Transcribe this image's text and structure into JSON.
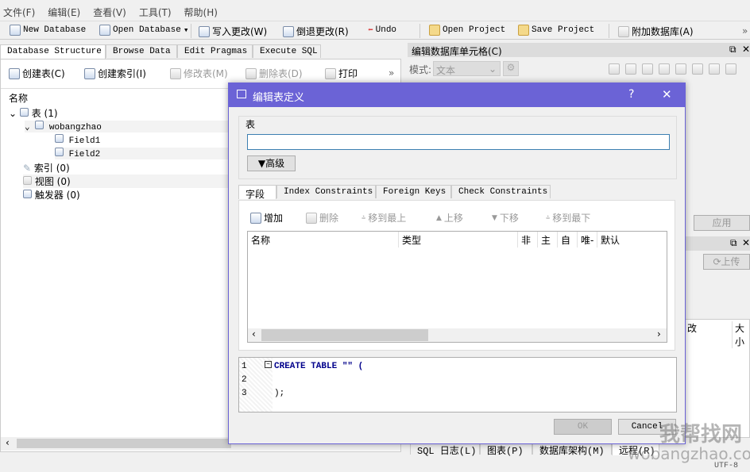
{
  "menu": [
    "文件(F)",
    "编辑(E)",
    "查看(V)",
    "工具(T)",
    "帮助(H)"
  ],
  "toolbar": {
    "new_db": "New Database",
    "open_db": "Open Database",
    "write": "写入更改(W)",
    "revert": "倒退更改(R)",
    "undo": "Undo",
    "open_project": "Open Project",
    "save_project": "Save Project",
    "attach": "附加数据库(A)",
    "more": "»"
  },
  "main_tabs": [
    "Database Structure",
    "Browse Data",
    "Edit Pragmas",
    "Execute SQL"
  ],
  "structure_toolbar": {
    "create_table": "创建表(C)",
    "create_index": "创建索引(I)",
    "modify_table": "修改表(M)",
    "delete_table": "删除表(D)",
    "print": "打印",
    "more": "»"
  },
  "tree": {
    "header": "名称",
    "items": [
      {
        "label": "表 (1)",
        "level": 0
      },
      {
        "label": "wobangzhao",
        "level": 1
      },
      {
        "label": "Field1",
        "level": 2
      },
      {
        "label": "Field2",
        "level": 2
      },
      {
        "label": "索引 (0)",
        "level": 0
      },
      {
        "label": "视图 (0)",
        "level": 0
      },
      {
        "label": "触发器 (0)",
        "level": 0
      }
    ]
  },
  "cell_dock": {
    "title": "编辑数据库单元格(C)",
    "mode_label": "模式:",
    "mode_value": "文本",
    "apply": "应用"
  },
  "remote_dock": {
    "upload": "上传",
    "col1": "改",
    "col2": "大小"
  },
  "bottom_tabs": [
    "SQL 日志(L)",
    "图表(P)",
    "数据库架构(M)",
    "远程(R)"
  ],
  "status": {
    "encoding": "UTF-8"
  },
  "dialog": {
    "title": "编辑表定义",
    "help": "?",
    "close": "✕",
    "group_label": "表",
    "table_name": "",
    "advanced": "高级",
    "tabs": [
      "字段",
      "Index Constraints",
      "Foreign Keys",
      "Check Constraints"
    ],
    "field_toolbar": {
      "add": "增加",
      "remove": "删除",
      "top": "移到最上",
      "up": "上移",
      "down": "下移",
      "bottom": "移到最下"
    },
    "columns": [
      "名称",
      "类型",
      "非空",
      "主键",
      "自增",
      "唯一",
      "默认"
    ],
    "columns_shown": [
      "名称",
      "类型",
      "非",
      "主",
      "自",
      "唯-",
      "默认"
    ],
    "sql_lines": [
      {
        "n": "1",
        "code": "CREATE TABLE \"\" ("
      },
      {
        "n": "2",
        "code": ""
      },
      {
        "n": "3",
        "code": ");"
      }
    ],
    "ok": "OK",
    "cancel": "Cancel",
    "title_color": "#6b63d6"
  },
  "watermark": {
    "cn": "我帮找网",
    "url": "wobangzhao.com"
  }
}
